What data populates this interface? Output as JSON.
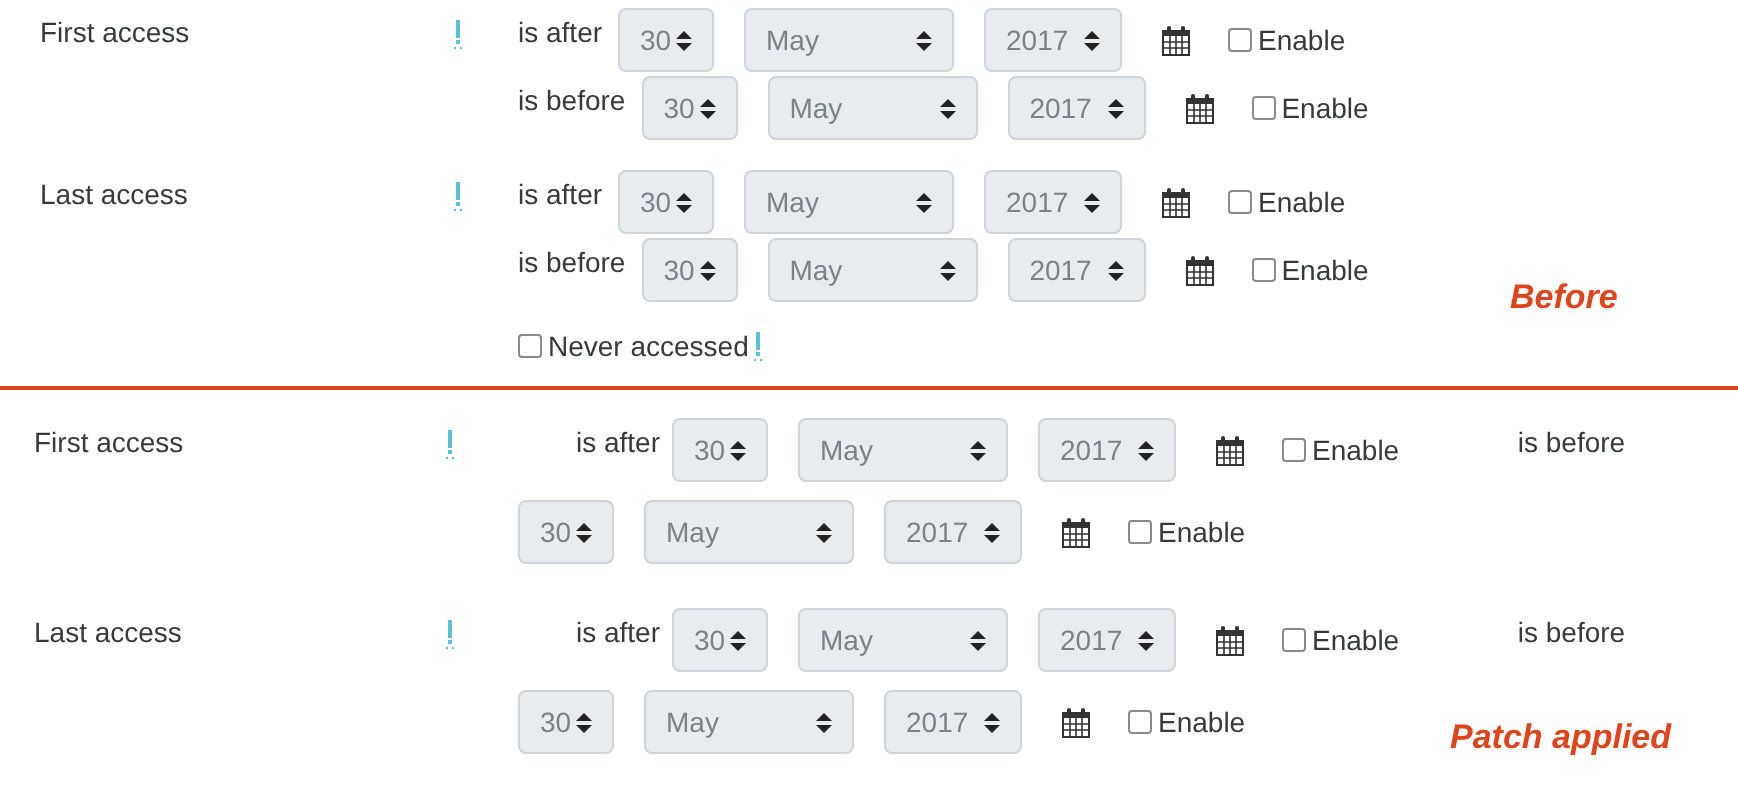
{
  "sections": [
    {
      "kind": "stacked",
      "caption": "Before",
      "fields": [
        {
          "label": "First access",
          "filters": [
            {
              "label": "is after",
              "day": "30",
              "month": "May",
              "year": "2017",
              "enable": {
                "label": "Enable",
                "checked": false
              }
            },
            {
              "label": "is before",
              "day": "30",
              "month": "May",
              "year": "2017",
              "enable": {
                "label": "Enable",
                "checked": false
              }
            }
          ]
        },
        {
          "label": "Last access",
          "filters": [
            {
              "label": "is after",
              "day": "30",
              "month": "May",
              "year": "2017",
              "enable": {
                "label": "Enable",
                "checked": false
              }
            },
            {
              "label": "is before",
              "day": "30",
              "month": "May",
              "year": "2017",
              "enable": {
                "label": "Enable",
                "checked": false
              }
            }
          ]
        }
      ],
      "never_accessed": {
        "label": "Never accessed",
        "checked": false
      }
    },
    {
      "kind": "inline",
      "caption": "Patch applied",
      "fields": [
        {
          "label": "First access",
          "filters": [
            {
              "label": "is after",
              "day": "30",
              "month": "May",
              "year": "2017",
              "enable": {
                "label": "Enable",
                "checked": false
              }
            },
            {
              "label": "is before",
              "day": "30",
              "month": "May",
              "year": "2017",
              "enable": {
                "label": "Enable",
                "checked": false
              }
            }
          ]
        },
        {
          "label": "Last access",
          "filters": [
            {
              "label": "is after",
              "day": "30",
              "month": "May",
              "year": "2017",
              "enable": {
                "label": "Enable",
                "checked": false
              }
            },
            {
              "label": "is before",
              "day": "30",
              "month": "May",
              "year": "2017",
              "enable": {
                "label": "Enable",
                "checked": false
              }
            }
          ]
        }
      ]
    }
  ]
}
